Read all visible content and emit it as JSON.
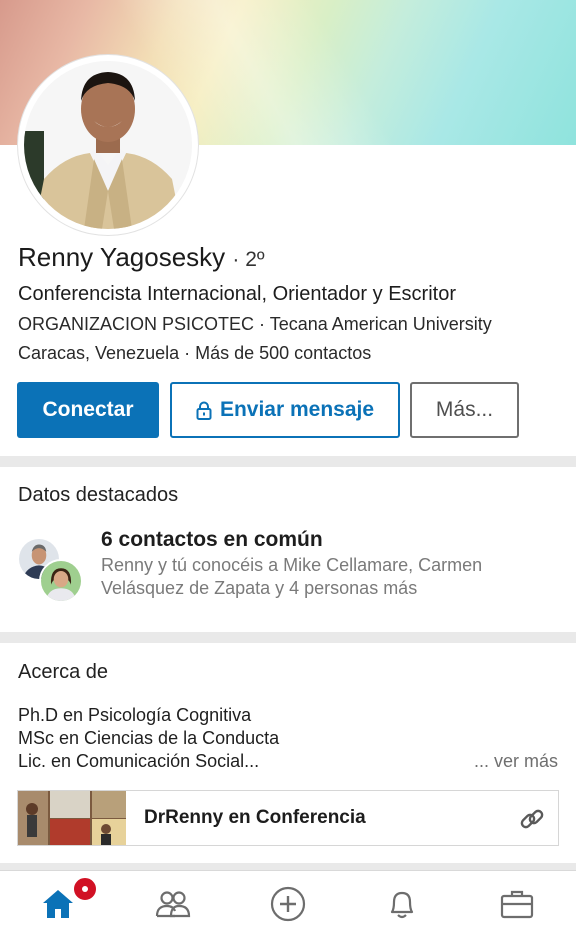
{
  "profile": {
    "name": "Renny Yagosesky",
    "degree": "· 2º",
    "headline": "Conferencista Internacional, Orientador y Escritor",
    "organizations": "ORGANIZACION PSICOTEC · Tecana American University",
    "location_connections": "Caracas, Venezuela · Más de 500 contactos"
  },
  "actions": {
    "connect_label": "Conectar",
    "message_label": "Enviar mensaje",
    "more_label": "Más..."
  },
  "highlights": {
    "title": "Datos destacados",
    "common_title": "6 contactos en común",
    "common_desc": "Renny y tú conocéis a Mike Cellamare, Carmen Velásquez de Zapata y 4 personas más"
  },
  "about": {
    "title": "Acerca de",
    "lines": [
      "Ph.D en Psicología Cognitiva",
      "MSc en Ciencias de la Conducta",
      "Lic. en Comunicación Social..."
    ],
    "see_more": "... ver más",
    "media_title": "DrRenny en Conferencia"
  },
  "nav": {
    "items": [
      "home-icon",
      "network-icon",
      "post-icon",
      "notifications-icon",
      "jobs-icon"
    ],
    "active": "home-icon",
    "badge_color": "#d11124"
  },
  "colors": {
    "brand_blue": "#0b72b7",
    "background": "#e9e9e9"
  }
}
